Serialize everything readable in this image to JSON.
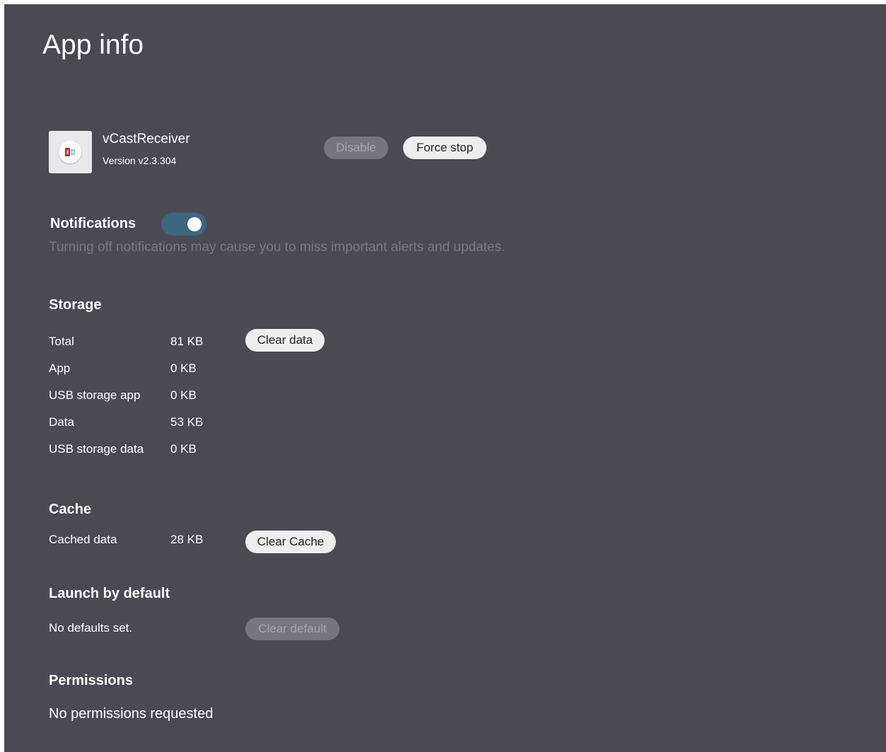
{
  "page": {
    "title": "App info"
  },
  "app": {
    "name": "vCastReceiver",
    "version": "Version v2.3.304",
    "icon": "vcast-app-icon"
  },
  "actions": {
    "disable_label": "Disable",
    "disable_enabled": false,
    "force_stop_label": "Force stop",
    "force_stop_enabled": true
  },
  "notifications": {
    "label": "Notifications",
    "enabled": true,
    "description": "Turning off notifications may cause you to miss important alerts and updates."
  },
  "storage": {
    "heading": "Storage",
    "rows": [
      {
        "label": "Total",
        "value": "81 KB"
      },
      {
        "label": "App",
        "value": "0 KB"
      },
      {
        "label": "USB storage app",
        "value": "0 KB"
      },
      {
        "label": "Data",
        "value": "53 KB"
      },
      {
        "label": "USB storage data",
        "value": "0 KB"
      }
    ],
    "clear_data_label": "Clear data"
  },
  "cache": {
    "heading": "Cache",
    "label": "Cached data",
    "value": "28 KB",
    "clear_cache_label": "Clear Cache"
  },
  "launch_default": {
    "heading": "Launch by default",
    "text": "No defaults set.",
    "clear_default_label": "Clear default",
    "clear_default_enabled": false
  },
  "permissions": {
    "heading": "Permissions",
    "text": "No permissions requested"
  },
  "colors": {
    "background": "#4b4a53",
    "toggle_on": "#3d6680",
    "button_enabled": "#eeeeee",
    "button_disabled": "#77767c",
    "muted_text": "#7a7980"
  }
}
